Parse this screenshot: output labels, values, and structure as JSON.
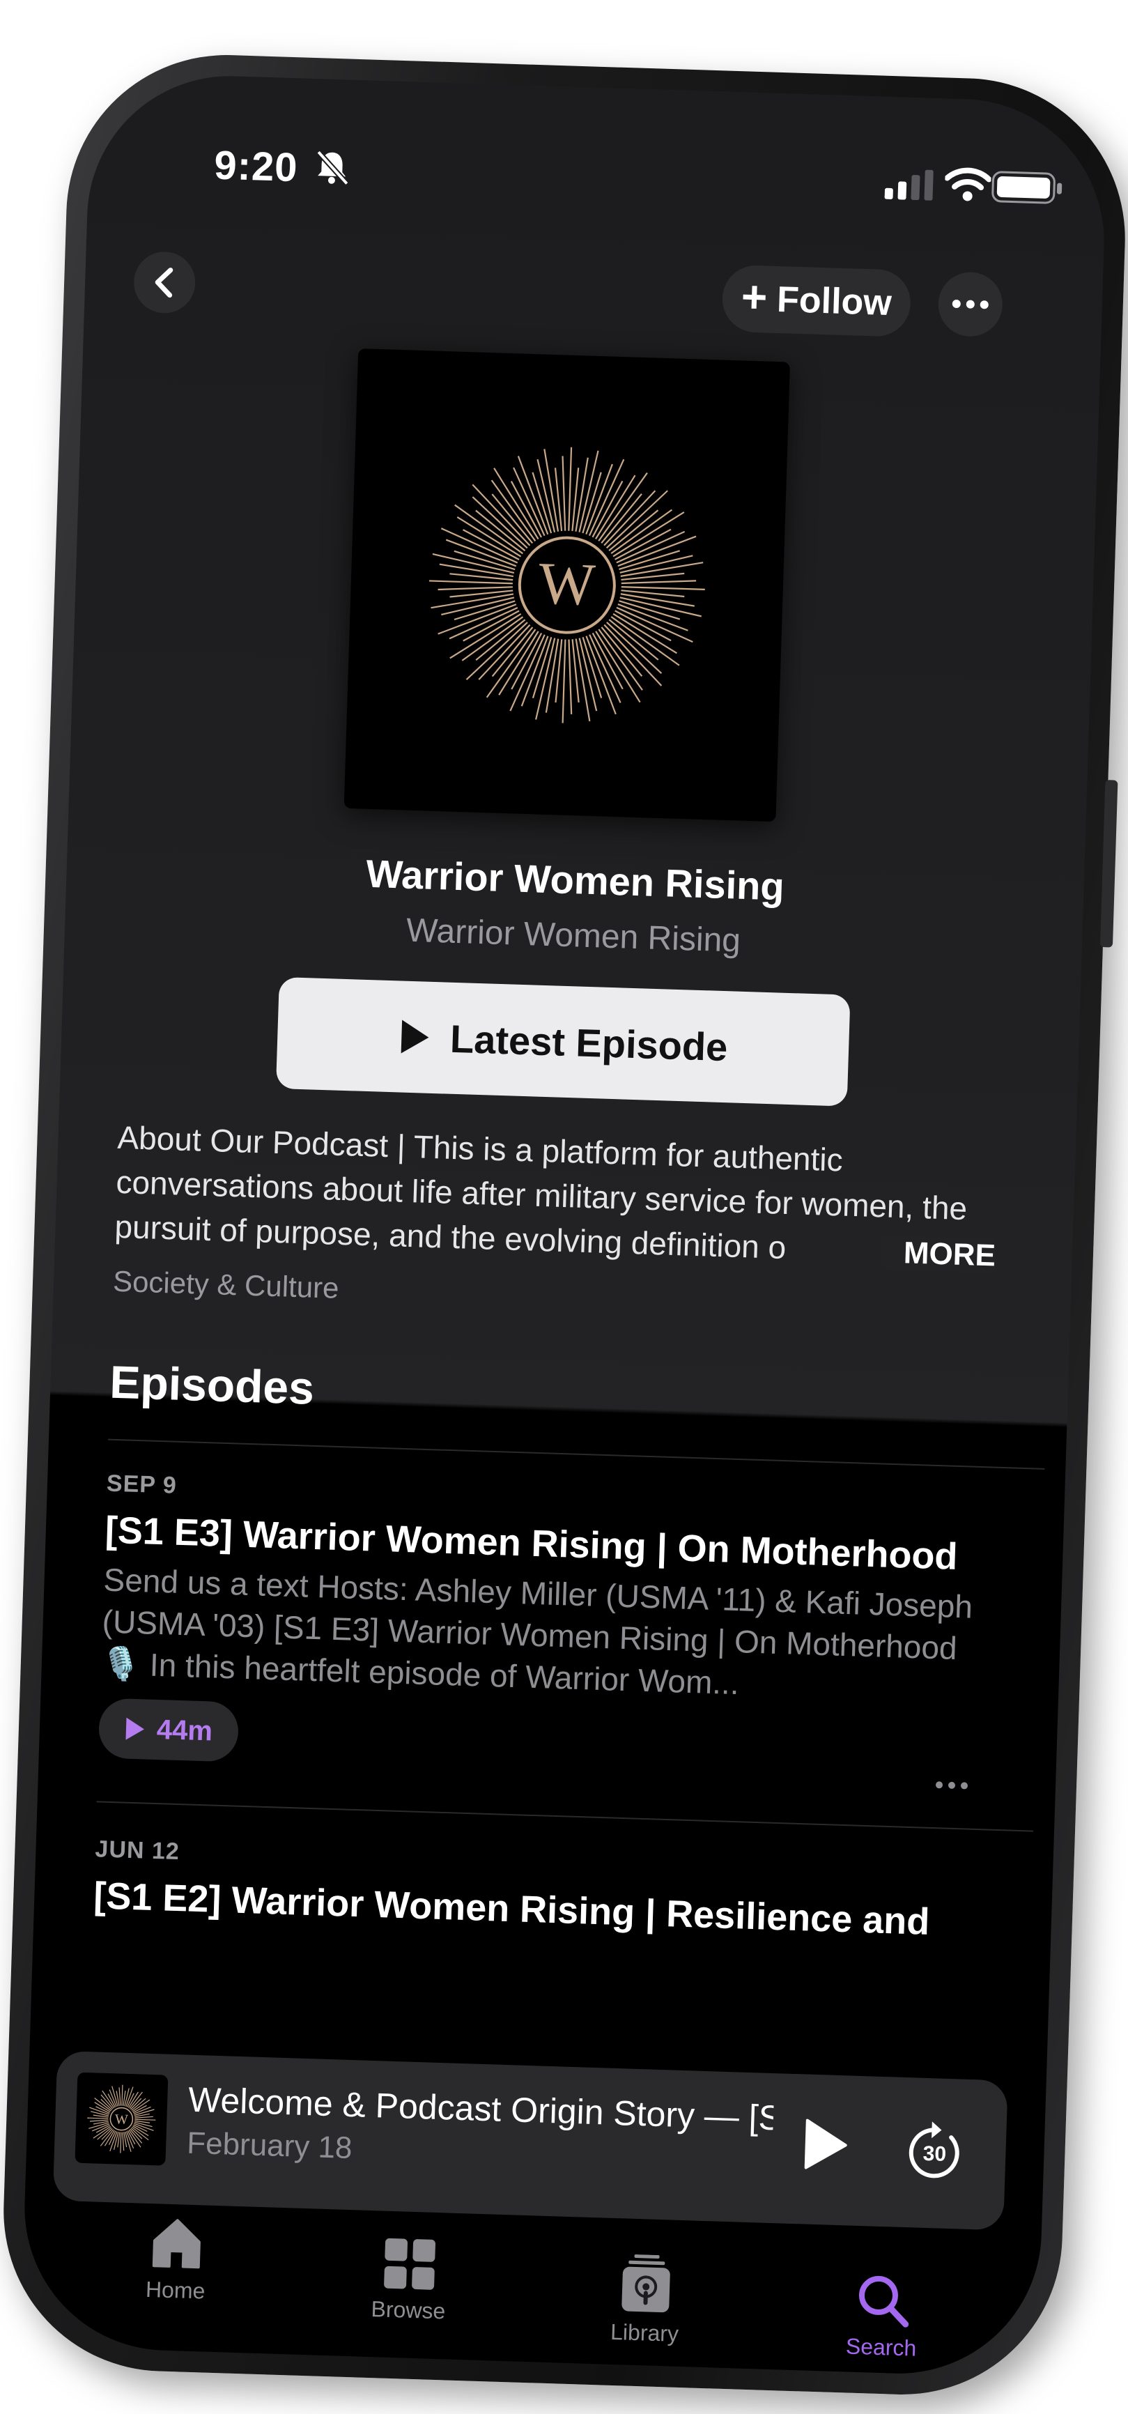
{
  "status_bar": {
    "time": "9:20",
    "icons": [
      "bell-slash-icon",
      "signal-icon",
      "wifi-icon",
      "battery-icon"
    ]
  },
  "nav": {
    "back_icon": "chevron-left-icon",
    "follow_label": "Follow",
    "more_icon": "ellipsis-icon"
  },
  "podcast": {
    "artwork_letter": "W",
    "title": "Warrior Women Rising",
    "author": "Warrior Women Rising",
    "latest_button_label": "Latest Episode",
    "description": "About Our Podcast | This is a platform for authentic conversations about life after military service for women, the pursuit of purpose, and the evolving definition o",
    "more_label": "MORE",
    "category": "Society & Culture"
  },
  "episodes": {
    "heading": "Episodes",
    "items": [
      {
        "date": "SEP 9",
        "title": "[S1 E3] Warrior Women Rising | On Motherhood",
        "summary": "Send us a text Hosts: Ashley Miller (USMA '11) & Kafi Joseph (USMA '03)  [S1 E3] Warrior Women Rising | On Motherhood 🎙️ In this heartfelt episode of Warrior Wom...",
        "duration": "44m"
      },
      {
        "date": "JUN 12",
        "title": "[S1 E2] Warrior Women Rising | Resilience and"
      }
    ]
  },
  "mini_player": {
    "title": "Welcome & Podcast Origin Story — [S",
    "subtitle": "February 18",
    "skip_label": "30"
  },
  "tab_bar": {
    "tabs": [
      {
        "label": "Home",
        "icon": "home-icon"
      },
      {
        "label": "Browse",
        "icon": "grid-icon"
      },
      {
        "label": "Library",
        "icon": "library-icon"
      },
      {
        "label": "Search",
        "icon": "search-icon"
      }
    ],
    "active": "Search"
  },
  "colors": {
    "accent": "#a468f0",
    "background": "#1c1c1e"
  }
}
